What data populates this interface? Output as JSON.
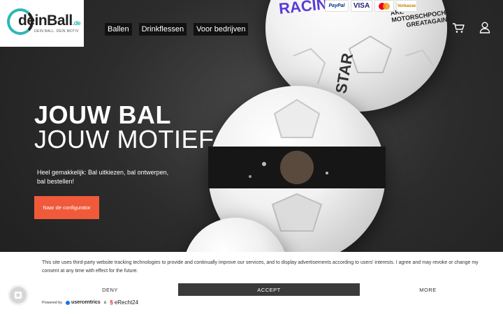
{
  "logo": {
    "brand": "deinBall",
    "suffix": ".de",
    "tagline": "DEIN BALL. DEIN MOTIV"
  },
  "nav": {
    "items": [
      "Ballen",
      "Drinkflessen",
      "Voor bedrijven"
    ]
  },
  "icons": {
    "cart": "cart-icon",
    "account": "user-icon",
    "privacy": "fingerprint-icon"
  },
  "payments": [
    "PayPal",
    "VISA",
    "mastercard",
    "Vorkasse"
  ],
  "hero": {
    "title": "JOUW BAL",
    "subtitle": "JOUW MOTIEF",
    "description": "Heel gemakkelijk: Bal uitkiezen, bal ontwerpen, bal bestellen!",
    "cta_label": "Naar de configurator"
  },
  "consent": {
    "text": "This site uses third-party website tracking technologies to provide and continually improve our services, and to display advertisements according to users' interests. I agree and may revoke or change my consent at any time with effect for the future.",
    "deny_label": "DENY",
    "accept_label": "ACCEPT",
    "more_label": "MORE",
    "powered_by": "Powered by",
    "provider": "usercentrics",
    "and": "&",
    "partner": "eRecht24"
  },
  "colors": {
    "accent": "#f05a3a",
    "logo_ring": "#2fb6b8",
    "accept_bg": "#3a3a3a"
  }
}
